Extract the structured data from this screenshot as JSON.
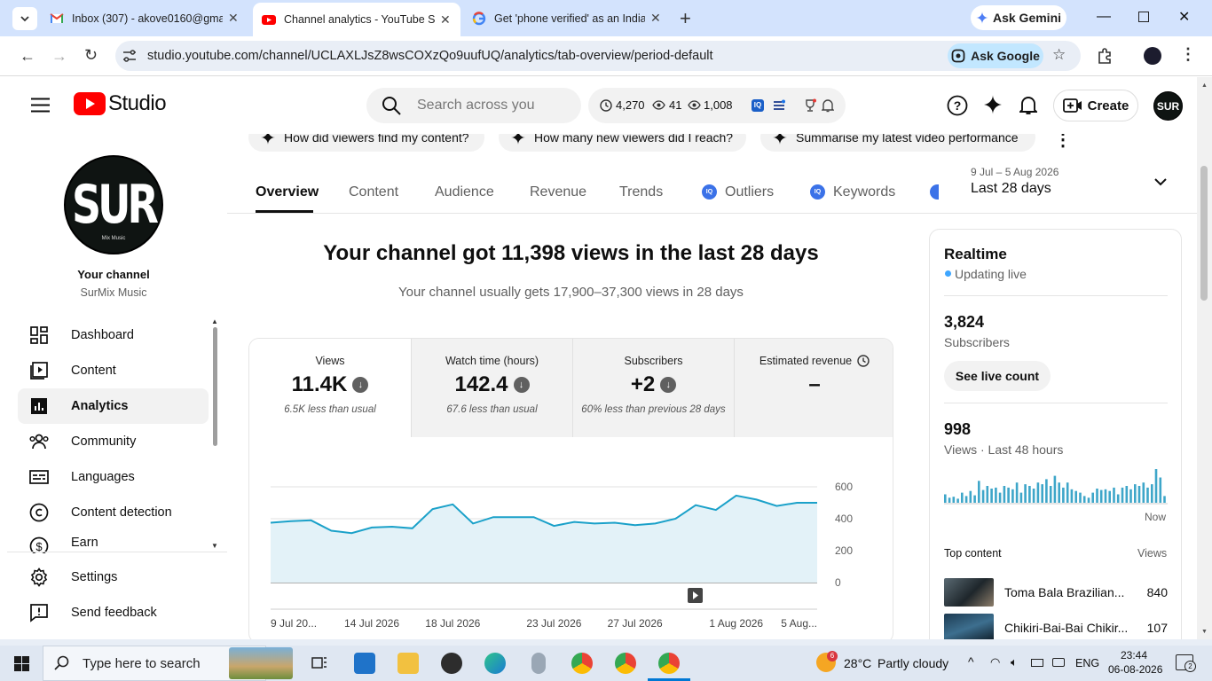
{
  "browser": {
    "tabs": [
      {
        "title": "Inbox (307) - akove0160@gmail",
        "icon": "gmail-icon"
      },
      {
        "title": "Channel analytics - YouTube Stu",
        "icon": "youtube-icon"
      },
      {
        "title": "Get 'phone verified' as an Indian",
        "icon": "google-icon"
      }
    ],
    "ask_gemini": "Ask Gemini",
    "url": "studio.youtube.com/channel/UCLAXLJsZ8wsCOXzQo9uufUQ/analytics/tab-overview/period-default",
    "ask_google": "Ask Google"
  },
  "header": {
    "logo_text": "Studio",
    "search_placeholder": "Search across you",
    "stat_clock": "4,270",
    "stat_eye1": "41",
    "stat_eye2": "1,008",
    "create_label": "Create"
  },
  "sidebar": {
    "channel_label": "Your channel",
    "channel_name": "SurMix Music",
    "avatar_text": "SUR",
    "avatar_sub": "Mix Music",
    "items": [
      {
        "label": "Dashboard",
        "icon": "dashboard-icon"
      },
      {
        "label": "Content",
        "icon": "content-icon"
      },
      {
        "label": "Analytics",
        "icon": "analytics-icon"
      },
      {
        "label": "Community",
        "icon": "community-icon"
      },
      {
        "label": "Languages",
        "icon": "languages-icon"
      },
      {
        "label": "Content detection",
        "icon": "copyright-icon"
      },
      {
        "label": "Earn",
        "icon": "earn-icon"
      }
    ],
    "settings": "Settings",
    "feedback": "Send feedback"
  },
  "chips": [
    "How did viewers find my content?",
    "How many new viewers did I reach?",
    "Summarise my latest video performance"
  ],
  "tabs": [
    "Overview",
    "Content",
    "Audience",
    "Revenue",
    "Trends",
    "Outliers",
    "Keywords"
  ],
  "period": {
    "range": "9 Jul – 5 Aug 2026",
    "label": "Last 28 days"
  },
  "headline": "Your channel got 11,398 views in the last 28 days",
  "subheadline": "Your channel usually gets 17,900–37,300 views in 28 days",
  "metrics": [
    {
      "label": "Views",
      "value": "11.4K",
      "sub": "6.5K less than usual"
    },
    {
      "label": "Watch time (hours)",
      "value": "142.4",
      "sub": "67.6 less than usual"
    },
    {
      "label": "Subscribers",
      "value": "+2",
      "sub": "60% less than previous 28 days"
    },
    {
      "label": "Estimated revenue",
      "value": "–",
      "sub": ""
    }
  ],
  "chart_data": {
    "type": "area",
    "x_ticks": [
      "9 Jul 20...",
      "14 Jul 2026",
      "18 Jul 2026",
      "23 Jul 2026",
      "27 Jul 2026",
      "1 Aug 2026",
      "5 Aug..."
    ],
    "y_ticks": [
      "600",
      "400",
      "200",
      "0"
    ],
    "ylim": [
      0,
      600
    ],
    "values": [
      375,
      385,
      390,
      325,
      310,
      345,
      350,
      340,
      460,
      490,
      370,
      410,
      410,
      410,
      355,
      380,
      370,
      375,
      360,
      370,
      400,
      485,
      455,
      545,
      520,
      480,
      500,
      500
    ],
    "color": "#1ba1c9"
  },
  "realtime": {
    "title": "Realtime",
    "status": "Updating live",
    "subs_value": "3,824",
    "subs_label": "Subscribers",
    "see_live": "See live count",
    "views_value": "998",
    "views_label": "Views · Last 48 hours",
    "now_label": "Now",
    "bars": [
      0.25,
      0.15,
      0.18,
      0.12,
      0.3,
      0.2,
      0.35,
      0.22,
      0.65,
      0.38,
      0.5,
      0.42,
      0.45,
      0.3,
      0.5,
      0.45,
      0.4,
      0.6,
      0.3,
      0.55,
      0.5,
      0.42,
      0.6,
      0.55,
      0.7,
      0.5,
      0.8,
      0.6,
      0.45,
      0.6,
      0.4,
      0.35,
      0.3,
      0.2,
      0.15,
      0.3,
      0.42,
      0.38,
      0.4,
      0.35,
      0.45,
      0.25,
      0.45,
      0.5,
      0.4,
      0.55,
      0.5,
      0.6,
      0.45,
      0.55,
      1.0,
      0.75,
      0.2
    ],
    "top_content_label": "Top content",
    "top_content_views": "Views",
    "top_items": [
      {
        "title": "Toma Bala Brazilian...",
        "views": "840"
      },
      {
        "title": "Chikiri-Bai-Bai Chikir...",
        "views": "107"
      }
    ]
  },
  "taskbar": {
    "search_placeholder": "Type here to search",
    "weather_temp": "28°C",
    "weather_desc": "Partly cloudy",
    "lang": "ENG",
    "time": "23:44",
    "date": "06-08-2026",
    "notif_count": "2",
    "weather_badge": "6"
  }
}
